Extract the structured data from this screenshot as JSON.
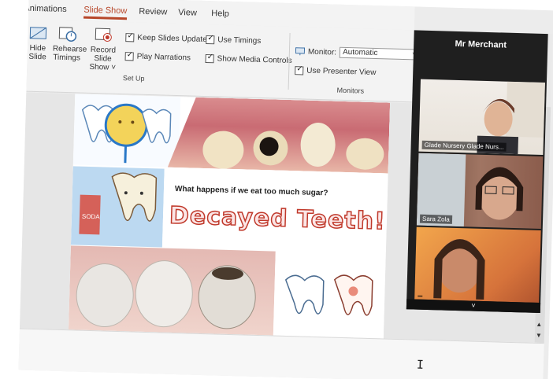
{
  "tabs": [
    "Animations",
    "Slide Show",
    "Review",
    "View",
    "Help"
  ],
  "active_tab": "Slide Show",
  "ribbon": {
    "hide_slide": "Hide Slide",
    "rehearse_timings": "Rehearse Timings",
    "record_slide_show": "Record Slide Show ˅",
    "keep_slides_updated": "Keep Slides Updated",
    "use_timings": "Use Timings",
    "play_narrations": "Play Narrations",
    "show_media_controls": "Show Media Controls",
    "setup_group": "Set Up",
    "monitor_label": "Monitor:",
    "monitor_value": "Automatic",
    "use_presenter_view": "Use Presenter View",
    "monitors_group": "Monitors"
  },
  "slide": {
    "question": "What happens if we eat too much sugar?",
    "title": "Decayed Teeth!",
    "soda_label": "SODA"
  },
  "zoom": {
    "host": "Mr Merchant",
    "participants": [
      {
        "name": "Glade Nursery Glade Nurs..."
      },
      {
        "name": "Sara Zola"
      },
      {
        "name": ""
      }
    ],
    "footer_chevron": "˅"
  },
  "colors": {
    "accent": "#b7472a",
    "title_stroke": "#c0392b",
    "zoom_bg": "#1f1f1f"
  }
}
